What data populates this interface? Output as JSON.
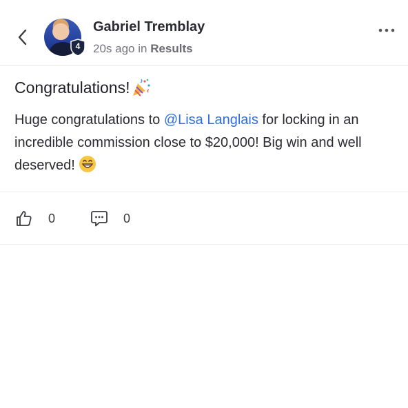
{
  "post": {
    "author": {
      "name": "Gabriel Tremblay",
      "level": "4"
    },
    "time": "20s ago",
    "in_label": "in",
    "group": "Results",
    "title": "Congratulations!",
    "body": {
      "before_mention": "Huge congratulations to ",
      "mention": "@Lisa Langlais",
      "after_mention": " for locking in an incredible commission close to $20,000! Big win and well deserved! "
    },
    "likes": "0",
    "comments": "0"
  },
  "icons": {
    "back": "chevron-left-icon",
    "more": "more-horizontal-icon",
    "badge": "shield-badge-icon",
    "title_emoji": "party-popper-emoji",
    "body_emoji": "grinning-face-emoji",
    "like": "thumbs-up-icon",
    "comment": "comment-bubble-icon"
  },
  "colors": {
    "mention": "#2f6fe0",
    "badge": "#1b2440",
    "divider": "#eeeef1"
  }
}
